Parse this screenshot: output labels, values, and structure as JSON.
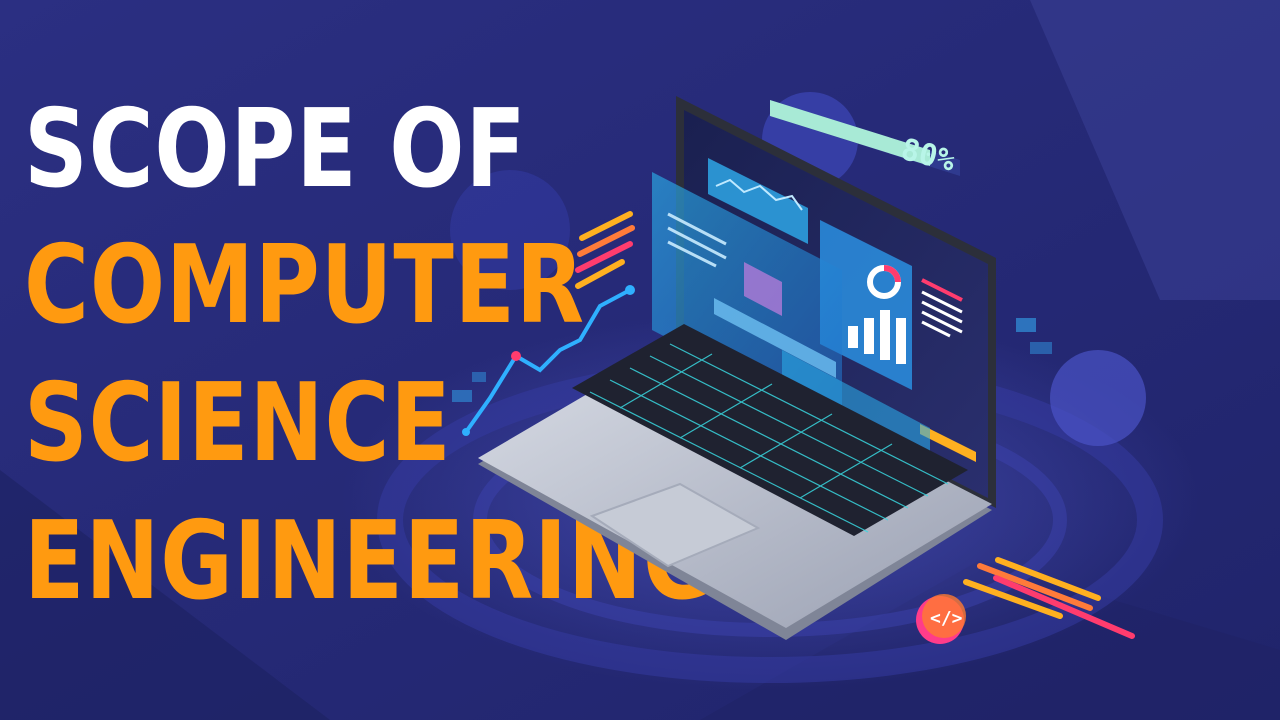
{
  "title": {
    "line1": "Scope of",
    "line2": "Computer",
    "line3": "Science",
    "line4": "Engineering"
  },
  "illustration": {
    "progress_label": "80%",
    "icons": [
      "laptop-icon",
      "dashboard-screen-icon",
      "line-chart-icon",
      "pie-chart-icon",
      "bar-chart-icon",
      "code-badge-icon"
    ]
  },
  "colors": {
    "background": "#262a78",
    "title_white": "#ffffff",
    "title_orange": "#ff9a10",
    "accent_cyan": "#27b6e8",
    "accent_pink": "#ff3c6e"
  }
}
